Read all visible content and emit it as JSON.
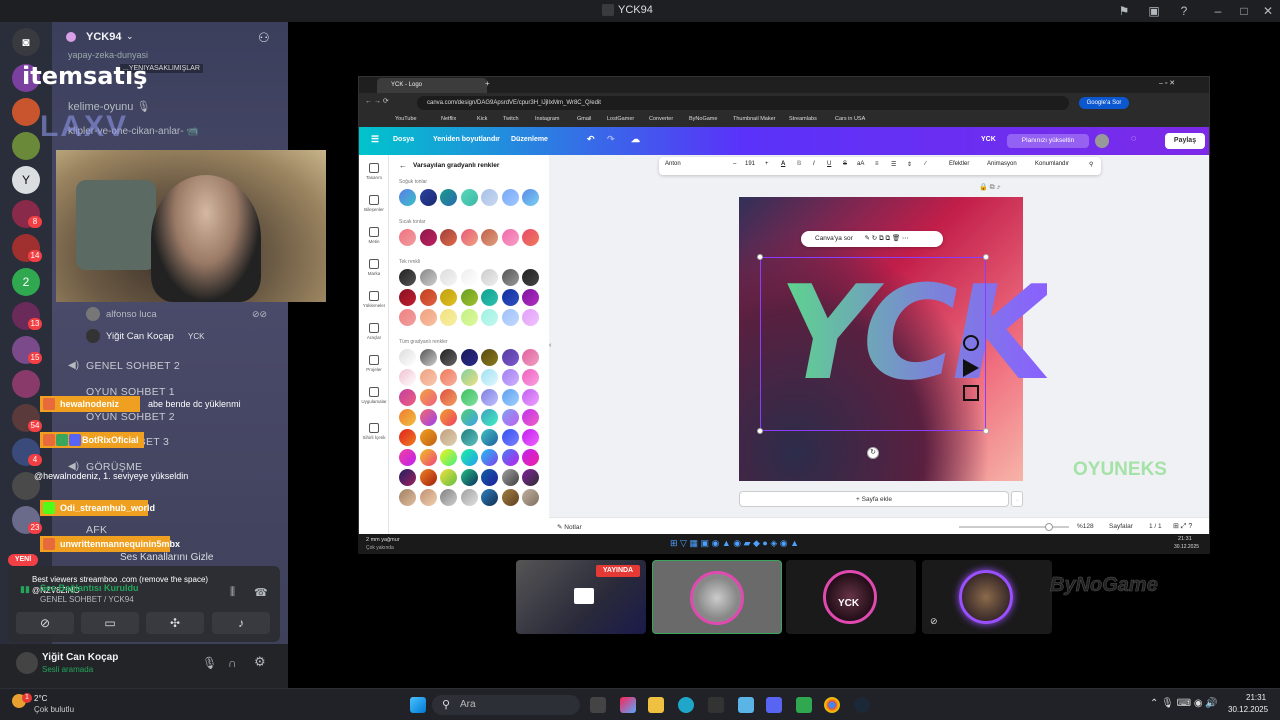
{
  "window": {
    "title": "YCK94"
  },
  "server": {
    "name": "YCK94"
  },
  "channels": {
    "text": [
      "yapay-zeka-dunyasi",
      "kelime-oyunu 🎙",
      "klipler-ve-one-cikan-anlar- 📹"
    ],
    "overlay_text": "...YENIYASAKLIMIŞLAR",
    "voice_members": [
      "alfonso luca",
      "Yiğit Can Koçap"
    ],
    "member_tag": "YCK",
    "voice_channels": [
      "GENEL SOHBET 2",
      "OYUN SOHBET 1",
      "OYUN SOHBET 2",
      "SOHBET 3",
      "GÖRÜŞME",
      "AFK"
    ]
  },
  "logo": {
    "brand": "itemsatış"
  },
  "rail": {
    "badges": [
      "8",
      "14",
      "13",
      "15",
      "54",
      "4",
      "23"
    ],
    "yeni": "YENİ"
  },
  "chat": [
    {
      "user": "hewalnodeniz",
      "message": "abe bende dc yüklenmi"
    },
    {
      "user": "BotRixOficial",
      "message": "@hewalnodeniz, 1. seviyeye yükseldin"
    },
    {
      "user": "Odi_streamhub_world",
      "message": ""
    },
    {
      "user": "unwrittenmannequinin5mbx",
      "message": "Best viewers streamboo .com (remove the space)"
    },
    {
      "user": "",
      "message": "@NZV8ZINO"
    }
  ],
  "voice": {
    "hide_channels": "Ses Kanallarını Gizle",
    "connected": "Ses Bağlantısı Kuruldu",
    "location": "GENEL SOHBET / YCK94"
  },
  "user": {
    "name": "Yiğit Can Koçap",
    "status": "Sesli aramada"
  },
  "browser": {
    "tab": "YCK - Logo",
    "url": "canva.com/design/DAG9ApsrdVE/cpur3H_lJjlIxMm_Wr8C_Q/edit",
    "ask": "Google'a Sor",
    "bookmarks": [
      "YouTube",
      "Netflix",
      "Kick",
      "Twitch",
      "Instagram",
      "Gmail",
      "LostGamer",
      "Converter",
      "ByNoGame",
      "Thumbnail Maker",
      "Streamlabs",
      "Cars in USA"
    ]
  },
  "canva": {
    "menu": {
      "file": "Dosya",
      "resize": "Yeniden boyutlandır",
      "edit": "Düzenleme"
    },
    "doc": "YCK",
    "upgrade": "Planınızı yükseltin",
    "share": "Paylaş",
    "sidebar": [
      "Tasarım",
      "Bileşenler",
      "Metin",
      "Marka",
      "Yüklemeler",
      "Araçlar",
      "Projeler",
      "Uygulamalar",
      "Sihirli İçerik"
    ],
    "panel": {
      "title": "Varsayılan gradyanlı renkler",
      "sections": [
        "Soğuk tonlar",
        "Sıcak tonlar",
        "Tek renkli",
        "Tüm gradyanlı renkler"
      ]
    },
    "toolbar": {
      "font": "Anton",
      "size": "191",
      "effects": "Efektler",
      "animate": "Animasyon",
      "position": "Konumlandır"
    },
    "design_text": "YCK",
    "ask_canva": "Canva'ya sor",
    "add_page": "+ Sayfa ekle",
    "notes": "Notlar",
    "zoom": "%128",
    "pages": "Sayfalar",
    "page_count": "1 / 1"
  },
  "inner_taskbar": {
    "weather": "2 mm yağmur",
    "weather_sub": "Çok yakında",
    "time": "21:31",
    "date": "30.12.2025"
  },
  "streams": {
    "live": "YAYINDA",
    "oyuneks": "OYUNEKS",
    "bynogame": "ByNoGame"
  },
  "taskbar": {
    "temp": "2°C",
    "weather": "Çok bulutlu",
    "search": "Ara",
    "time": "21:31",
    "date": "30.12.2025"
  },
  "colors": {
    "accent": "#7d2ae8",
    "discord_bg": "#313338",
    "badge": "#f0a020"
  }
}
